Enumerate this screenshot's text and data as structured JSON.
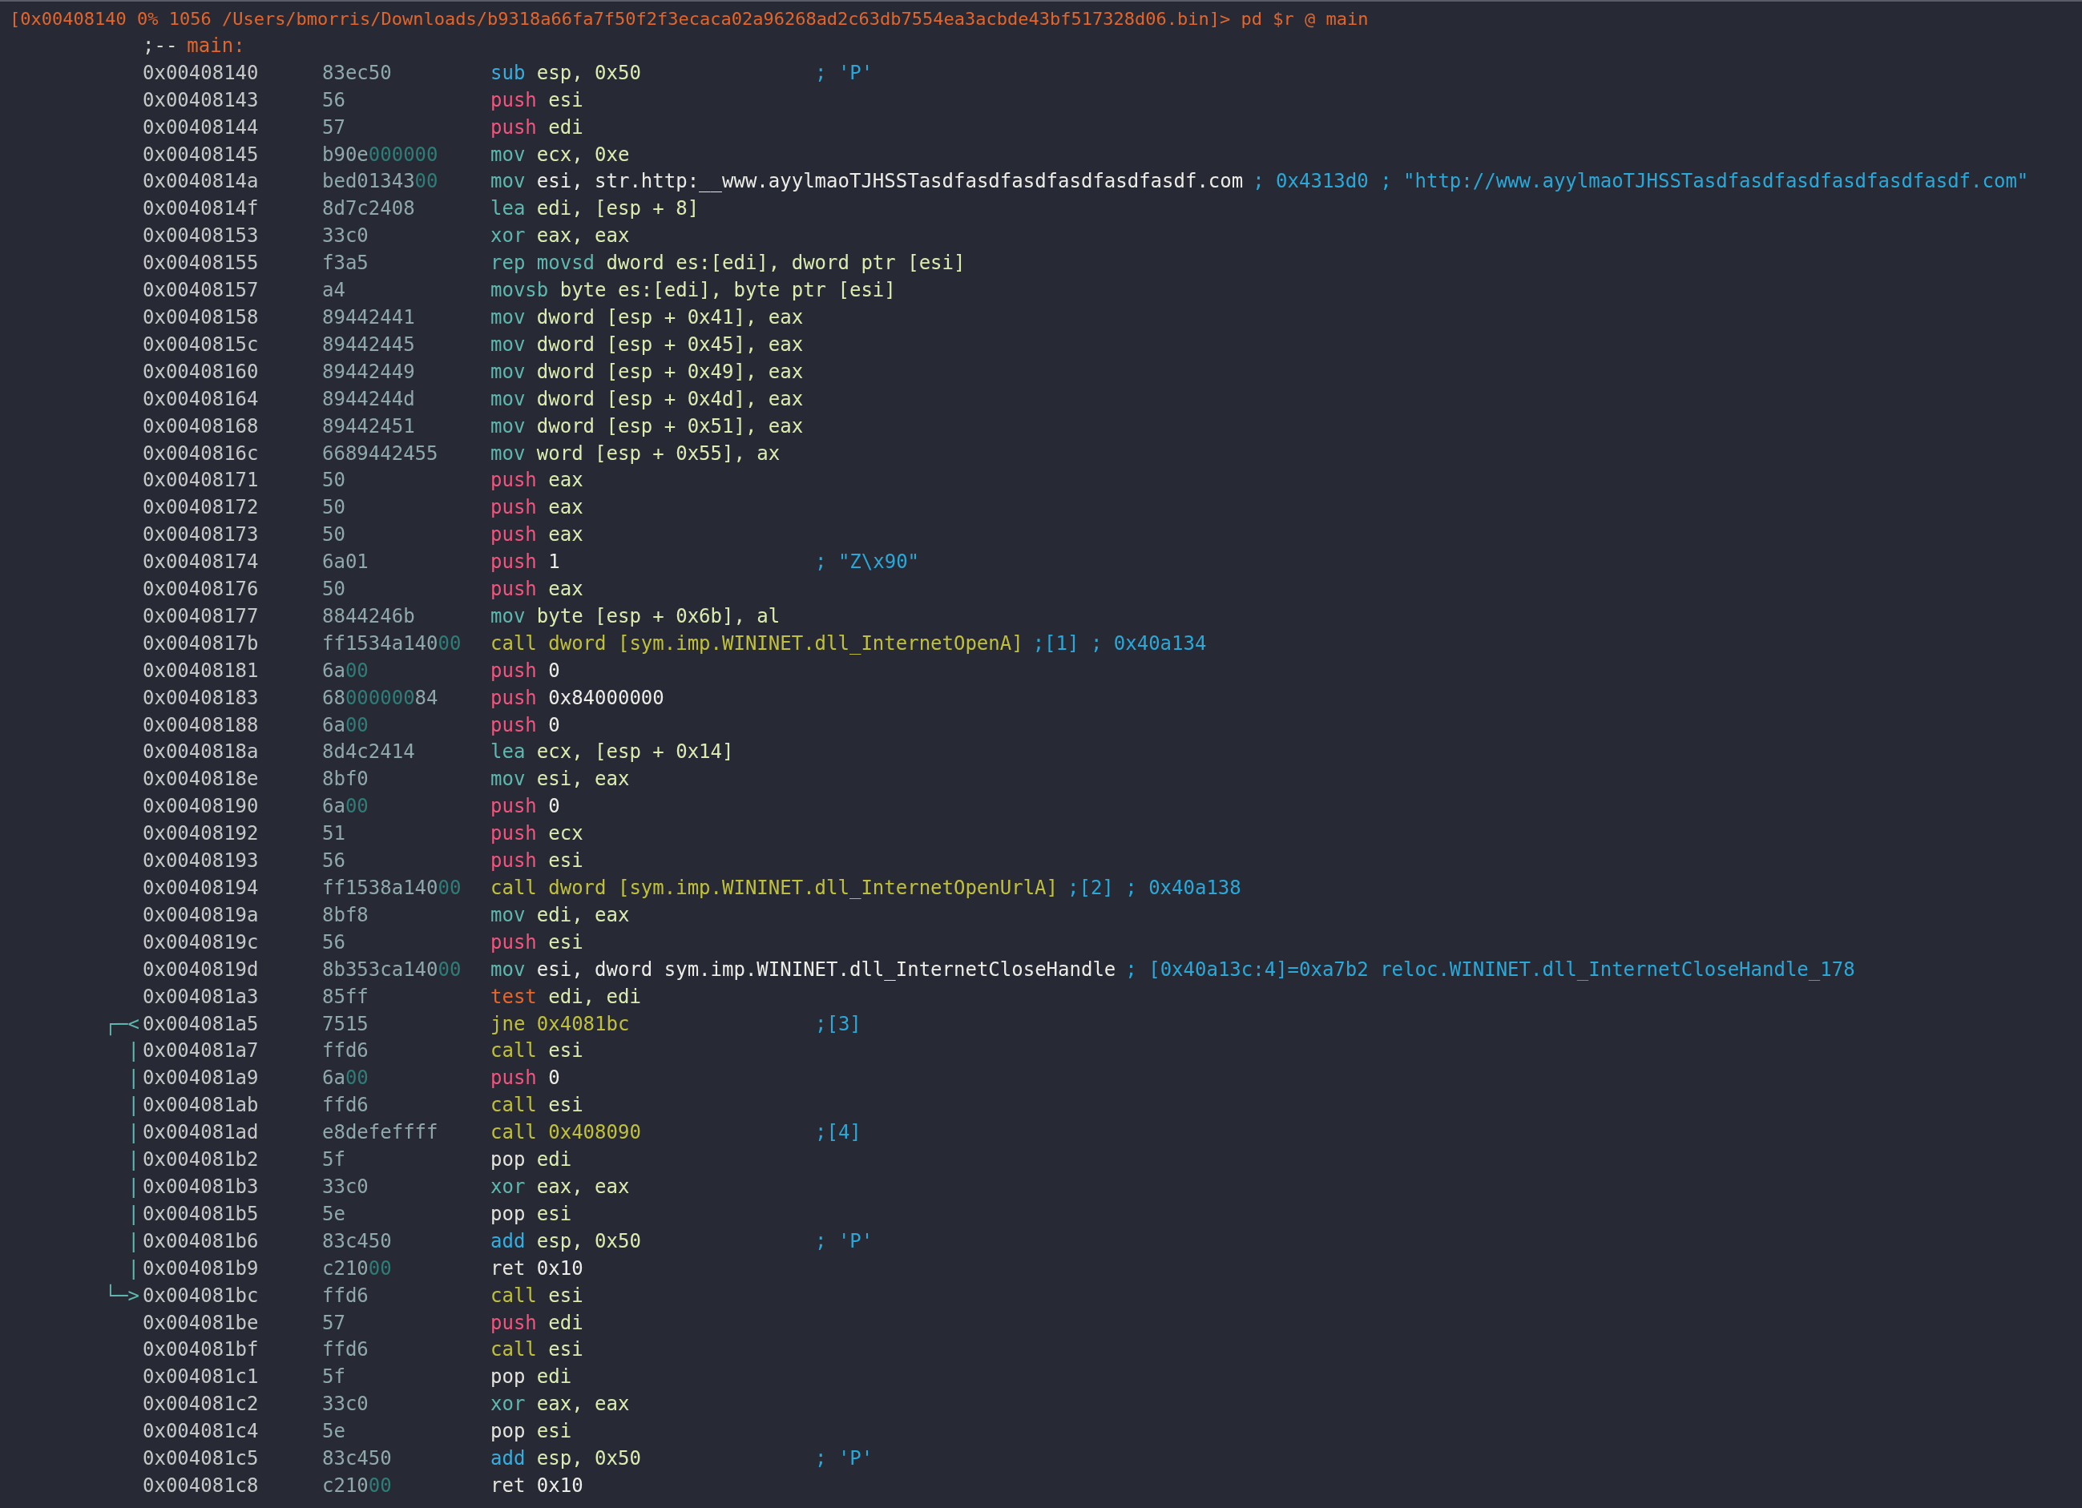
{
  "prompt": {
    "text": "[0x00408140 0% 1056 /Users/bmorris/Downloads/b9318a66fa7f50f2f3ecaca02a96268ad2c63db7554ea3acbde43bf517328d06.bin]> pd $r @ main"
  },
  "flag": {
    "prefix": ";--",
    "name": "main:"
  },
  "rows": [
    {
      "address": "0x00408140",
      "bytes": [
        {
          "text": "83ec50",
          "kind": "plain"
        }
      ],
      "mnemonic": "sub",
      "kind": "arith",
      "operands": {
        "text": "esp, 0x50",
        "kind": "reg"
      },
      "comment": "; 'P'"
    },
    {
      "address": "0x00408143",
      "bytes": [
        {
          "text": "56",
          "kind": "plain"
        }
      ],
      "mnemonic": "push",
      "kind": "stack",
      "operands": {
        "text": "esi",
        "kind": "reg"
      }
    },
    {
      "address": "0x00408144",
      "bytes": [
        {
          "text": "57",
          "kind": "plain"
        }
      ],
      "mnemonic": "push",
      "kind": "stack",
      "operands": {
        "text": "edi",
        "kind": "reg"
      }
    },
    {
      "address": "0x00408145",
      "bytes": [
        {
          "text": "b90e",
          "kind": "plain"
        },
        {
          "text": "000000",
          "kind": "zero"
        }
      ],
      "mnemonic": "mov",
      "kind": "move",
      "operands": {
        "text": "ecx, 0xe",
        "kind": "reg"
      }
    },
    {
      "address": "0x0040814a",
      "bytes": [
        {
          "text": "bed01343",
          "kind": "plain"
        },
        {
          "text": "00",
          "kind": "zero"
        }
      ],
      "mnemonic": "mov",
      "kind": "move",
      "operands": {
        "text": "esi, str.http:__www.ayylmaoTJHSSTasdfasdfasdfasdfasdfasdf.com",
        "kind": "lit"
      },
      "comment": "; 0x4313d0 ; \"http://www.ayylmaoTJHSSTasdfasdfasdfasdfasdfasdf.com\""
    },
    {
      "address": "0x0040814f",
      "bytes": [
        {
          "text": "8d7c2408",
          "kind": "plain"
        }
      ],
      "mnemonic": "lea",
      "kind": "move",
      "operands": {
        "text": "edi, [esp + 8]",
        "kind": "reg"
      }
    },
    {
      "address": "0x00408153",
      "bytes": [
        {
          "text": "33c0",
          "kind": "plain"
        }
      ],
      "mnemonic": "xor",
      "kind": "move",
      "operands": {
        "text": "eax, eax",
        "kind": "reg"
      }
    },
    {
      "address": "0x00408155",
      "bytes": [
        {
          "text": "f3a5",
          "kind": "plain"
        }
      ],
      "mnemonic": "rep movsd",
      "kind": "move",
      "operands": {
        "text": "dword es:[edi], dword ptr [esi]",
        "kind": "reg"
      }
    },
    {
      "address": "0x00408157",
      "bytes": [
        {
          "text": "a4",
          "kind": "plain"
        }
      ],
      "mnemonic": "movsb",
      "kind": "move",
      "operands": {
        "text": "byte es:[edi], byte ptr [esi]",
        "kind": "reg"
      }
    },
    {
      "address": "0x00408158",
      "bytes": [
        {
          "text": "89442441",
          "kind": "plain"
        }
      ],
      "mnemonic": "mov",
      "kind": "move",
      "operands": {
        "text": "dword [esp + 0x41], eax",
        "kind": "reg"
      }
    },
    {
      "address": "0x0040815c",
      "bytes": [
        {
          "text": "89442445",
          "kind": "plain"
        }
      ],
      "mnemonic": "mov",
      "kind": "move",
      "operands": {
        "text": "dword [esp + 0x45], eax",
        "kind": "reg"
      }
    },
    {
      "address": "0x00408160",
      "bytes": [
        {
          "text": "89442449",
          "kind": "plain"
        }
      ],
      "mnemonic": "mov",
      "kind": "move",
      "operands": {
        "text": "dword [esp + 0x49], eax",
        "kind": "reg"
      }
    },
    {
      "address": "0x00408164",
      "bytes": [
        {
          "text": "8944244d",
          "kind": "plain"
        }
      ],
      "mnemonic": "mov",
      "kind": "move",
      "operands": {
        "text": "dword [esp + 0x4d], eax",
        "kind": "reg"
      }
    },
    {
      "address": "0x00408168",
      "bytes": [
        {
          "text": "89442451",
          "kind": "plain"
        }
      ],
      "mnemonic": "mov",
      "kind": "move",
      "operands": {
        "text": "dword [esp + 0x51], eax",
        "kind": "reg"
      }
    },
    {
      "address": "0x0040816c",
      "bytes": [
        {
          "text": "6689442455",
          "kind": "plain"
        }
      ],
      "mnemonic": "mov",
      "kind": "move",
      "operands": {
        "text": "word [esp + 0x55], ax",
        "kind": "reg"
      }
    },
    {
      "address": "0x00408171",
      "bytes": [
        {
          "text": "50",
          "kind": "plain"
        }
      ],
      "mnemonic": "push",
      "kind": "stack",
      "operands": {
        "text": "eax",
        "kind": "reg"
      }
    },
    {
      "address": "0x00408172",
      "bytes": [
        {
          "text": "50",
          "kind": "plain"
        }
      ],
      "mnemonic": "push",
      "kind": "stack",
      "operands": {
        "text": "eax",
        "kind": "reg"
      }
    },
    {
      "address": "0x00408173",
      "bytes": [
        {
          "text": "50",
          "kind": "plain"
        }
      ],
      "mnemonic": "push",
      "kind": "stack",
      "operands": {
        "text": "eax",
        "kind": "reg"
      }
    },
    {
      "address": "0x00408174",
      "bytes": [
        {
          "text": "6a01",
          "kind": "plain"
        }
      ],
      "mnemonic": "push",
      "kind": "stack",
      "operands": {
        "text": "1",
        "kind": "lit"
      },
      "comment": "; \"Z\\x90\""
    },
    {
      "address": "0x00408176",
      "bytes": [
        {
          "text": "50",
          "kind": "plain"
        }
      ],
      "mnemonic": "push",
      "kind": "stack",
      "operands": {
        "text": "eax",
        "kind": "reg"
      }
    },
    {
      "address": "0x00408177",
      "bytes": [
        {
          "text": "8844246b",
          "kind": "plain"
        }
      ],
      "mnemonic": "mov",
      "kind": "move",
      "operands": {
        "text": "byte [esp + 0x6b], al",
        "kind": "reg"
      }
    },
    {
      "address": "0x0040817b",
      "bytes": [
        {
          "text": "ff1534a140",
          "kind": "plain"
        },
        {
          "text": "00",
          "kind": "zero"
        }
      ],
      "mnemonic": "call",
      "kind": "branch",
      "operands": {
        "text": "dword [sym.imp.WININET.dll_InternetOpenA]",
        "kind": "sym"
      },
      "comment": ";[1] ; 0x40a134"
    },
    {
      "address": "0x00408181",
      "bytes": [
        {
          "text": "6a",
          "kind": "plain"
        },
        {
          "text": "00",
          "kind": "zero"
        }
      ],
      "mnemonic": "push",
      "kind": "stack",
      "operands": {
        "text": "0",
        "kind": "lit"
      }
    },
    {
      "address": "0x00408183",
      "bytes": [
        {
          "text": "68",
          "kind": "plain"
        },
        {
          "text": "000000",
          "kind": "zero"
        },
        {
          "text": "84",
          "kind": "plain"
        }
      ],
      "mnemonic": "push",
      "kind": "stack",
      "operands": {
        "text": "0x84000000",
        "kind": "lit"
      }
    },
    {
      "address": "0x00408188",
      "bytes": [
        {
          "text": "6a",
          "kind": "plain"
        },
        {
          "text": "00",
          "kind": "zero"
        }
      ],
      "mnemonic": "push",
      "kind": "stack",
      "operands": {
        "text": "0",
        "kind": "lit"
      }
    },
    {
      "address": "0x0040818a",
      "bytes": [
        {
          "text": "8d4c2414",
          "kind": "plain"
        }
      ],
      "mnemonic": "lea",
      "kind": "move",
      "operands": {
        "text": "ecx, [esp + 0x14]",
        "kind": "reg"
      }
    },
    {
      "address": "0x0040818e",
      "bytes": [
        {
          "text": "8bf0",
          "kind": "plain"
        }
      ],
      "mnemonic": "mov",
      "kind": "move",
      "operands": {
        "text": "esi, eax",
        "kind": "reg"
      }
    },
    {
      "address": "0x00408190",
      "bytes": [
        {
          "text": "6a",
          "kind": "plain"
        },
        {
          "text": "00",
          "kind": "zero"
        }
      ],
      "mnemonic": "push",
      "kind": "stack",
      "operands": {
        "text": "0",
        "kind": "lit"
      }
    },
    {
      "address": "0x00408192",
      "bytes": [
        {
          "text": "51",
          "kind": "plain"
        }
      ],
      "mnemonic": "push",
      "kind": "stack",
      "operands": {
        "text": "ecx",
        "kind": "reg"
      }
    },
    {
      "address": "0x00408193",
      "bytes": [
        {
          "text": "56",
          "kind": "plain"
        }
      ],
      "mnemonic": "push",
      "kind": "stack",
      "operands": {
        "text": "esi",
        "kind": "reg"
      }
    },
    {
      "address": "0x00408194",
      "bytes": [
        {
          "text": "ff1538a140",
          "kind": "plain"
        },
        {
          "text": "00",
          "kind": "zero"
        }
      ],
      "mnemonic": "call",
      "kind": "branch",
      "operands": {
        "text": "dword [sym.imp.WININET.dll_InternetOpenUrlA]",
        "kind": "sym"
      },
      "comment": ";[2] ; 0x40a138"
    },
    {
      "address": "0x0040819a",
      "bytes": [
        {
          "text": "8bf8",
          "kind": "plain"
        }
      ],
      "mnemonic": "mov",
      "kind": "move",
      "operands": {
        "text": "edi, eax",
        "kind": "reg"
      }
    },
    {
      "address": "0x0040819c",
      "bytes": [
        {
          "text": "56",
          "kind": "plain"
        }
      ],
      "mnemonic": "push",
      "kind": "stack",
      "operands": {
        "text": "esi",
        "kind": "reg"
      }
    },
    {
      "address": "0x0040819d",
      "bytes": [
        {
          "text": "8b353ca140",
          "kind": "plain"
        },
        {
          "text": "00",
          "kind": "zero"
        }
      ],
      "mnemonic": "mov",
      "kind": "move",
      "operands": {
        "text": "esi, dword sym.imp.WININET.dll_InternetCloseHandle",
        "kind": "lit"
      },
      "comment": "; [0x40a13c:4]=0xa7b2 reloc.WININET.dll_InternetCloseHandle_178"
    },
    {
      "address": "0x004081a3",
      "bytes": [
        {
          "text": "85ff",
          "kind": "plain"
        }
      ],
      "mnemonic": "test",
      "kind": "compare",
      "operands": {
        "text": "edi, edi",
        "kind": "reg"
      }
    },
    {
      "arrow": "┌─<",
      "address": "0x004081a5",
      "bytes": [
        {
          "text": "7515",
          "kind": "plain"
        }
      ],
      "mnemonic": "jne",
      "kind": "branch",
      "operands": {
        "text": "0x4081bc",
        "kind": "sym"
      },
      "comment": ";[3]"
    },
    {
      "arrow": "|",
      "address": "0x004081a7",
      "bytes": [
        {
          "text": "ffd6",
          "kind": "plain"
        }
      ],
      "mnemonic": "call",
      "kind": "branch",
      "operands": {
        "text": "esi",
        "kind": "reg"
      }
    },
    {
      "arrow": "|",
      "address": "0x004081a9",
      "bytes": [
        {
          "text": "6a",
          "kind": "plain"
        },
        {
          "text": "00",
          "kind": "zero"
        }
      ],
      "mnemonic": "push",
      "kind": "stack",
      "operands": {
        "text": "0",
        "kind": "lit"
      }
    },
    {
      "arrow": "|",
      "address": "0x004081ab",
      "bytes": [
        {
          "text": "ffd6",
          "kind": "plain"
        }
      ],
      "mnemonic": "call",
      "kind": "branch",
      "operands": {
        "text": "esi",
        "kind": "reg"
      }
    },
    {
      "arrow": "|",
      "address": "0x004081ad",
      "bytes": [
        {
          "text": "e8defeffff",
          "kind": "plain"
        }
      ],
      "mnemonic": "call",
      "kind": "branch",
      "operands": {
        "text": "0x408090",
        "kind": "sym"
      },
      "comment": ";[4]"
    },
    {
      "arrow": "|",
      "address": "0x004081b2",
      "bytes": [
        {
          "text": "5f",
          "kind": "plain"
        }
      ],
      "mnemonic": "pop",
      "kind": "plain",
      "operands": {
        "text": "edi",
        "kind": "reg"
      }
    },
    {
      "arrow": "|",
      "address": "0x004081b3",
      "bytes": [
        {
          "text": "33c0",
          "kind": "plain"
        }
      ],
      "mnemonic": "xor",
      "kind": "move",
      "operands": {
        "text": "eax, eax",
        "kind": "reg"
      }
    },
    {
      "arrow": "|",
      "address": "0x004081b5",
      "bytes": [
        {
          "text": "5e",
          "kind": "plain"
        }
      ],
      "mnemonic": "pop",
      "kind": "plain",
      "operands": {
        "text": "esi",
        "kind": "reg"
      }
    },
    {
      "arrow": "|",
      "address": "0x004081b6",
      "bytes": [
        {
          "text": "83c450",
          "kind": "plain"
        }
      ],
      "mnemonic": "add",
      "kind": "arith",
      "operands": {
        "text": "esp, 0x50",
        "kind": "reg"
      },
      "comment": "; 'P'"
    },
    {
      "arrow": "|",
      "address": "0x004081b9",
      "bytes": [
        {
          "text": "c210",
          "kind": "plain"
        },
        {
          "text": "00",
          "kind": "zero"
        }
      ],
      "mnemonic": "ret",
      "kind": "plain",
      "operands": {
        "text": "0x10",
        "kind": "lit"
      }
    },
    {
      "arrow": "└─>",
      "address": "0x004081bc",
      "bytes": [
        {
          "text": "ffd6",
          "kind": "plain"
        }
      ],
      "mnemonic": "call",
      "kind": "branch",
      "operands": {
        "text": "esi",
        "kind": "reg"
      }
    },
    {
      "address": "0x004081be",
      "bytes": [
        {
          "text": "57",
          "kind": "plain"
        }
      ],
      "mnemonic": "push",
      "kind": "stack",
      "operands": {
        "text": "edi",
        "kind": "reg"
      }
    },
    {
      "address": "0x004081bf",
      "bytes": [
        {
          "text": "ffd6",
          "kind": "plain"
        }
      ],
      "mnemonic": "call",
      "kind": "branch",
      "operands": {
        "text": "esi",
        "kind": "reg"
      }
    },
    {
      "address": "0x004081c1",
      "bytes": [
        {
          "text": "5f",
          "kind": "plain"
        }
      ],
      "mnemonic": "pop",
      "kind": "plain",
      "operands": {
        "text": "edi",
        "kind": "reg"
      }
    },
    {
      "address": "0x004081c2",
      "bytes": [
        {
          "text": "33c0",
          "kind": "plain"
        }
      ],
      "mnemonic": "xor",
      "kind": "move",
      "operands": {
        "text": "eax, eax",
        "kind": "reg"
      }
    },
    {
      "address": "0x004081c4",
      "bytes": [
        {
          "text": "5e",
          "kind": "plain"
        }
      ],
      "mnemonic": "pop",
      "kind": "plain",
      "operands": {
        "text": "esi",
        "kind": "reg"
      }
    },
    {
      "address": "0x004081c5",
      "bytes": [
        {
          "text": "83c450",
          "kind": "plain"
        }
      ],
      "mnemonic": "add",
      "kind": "arith",
      "operands": {
        "text": "esp, 0x50",
        "kind": "reg"
      },
      "comment": "; 'P'"
    },
    {
      "address": "0x004081c8",
      "bytes": [
        {
          "text": "c210",
          "kind": "plain"
        },
        {
          "text": "00",
          "kind": "zero"
        }
      ],
      "mnemonic": "ret",
      "kind": "plain",
      "operands": {
        "text": "0x10",
        "kind": "lit"
      }
    }
  ]
}
